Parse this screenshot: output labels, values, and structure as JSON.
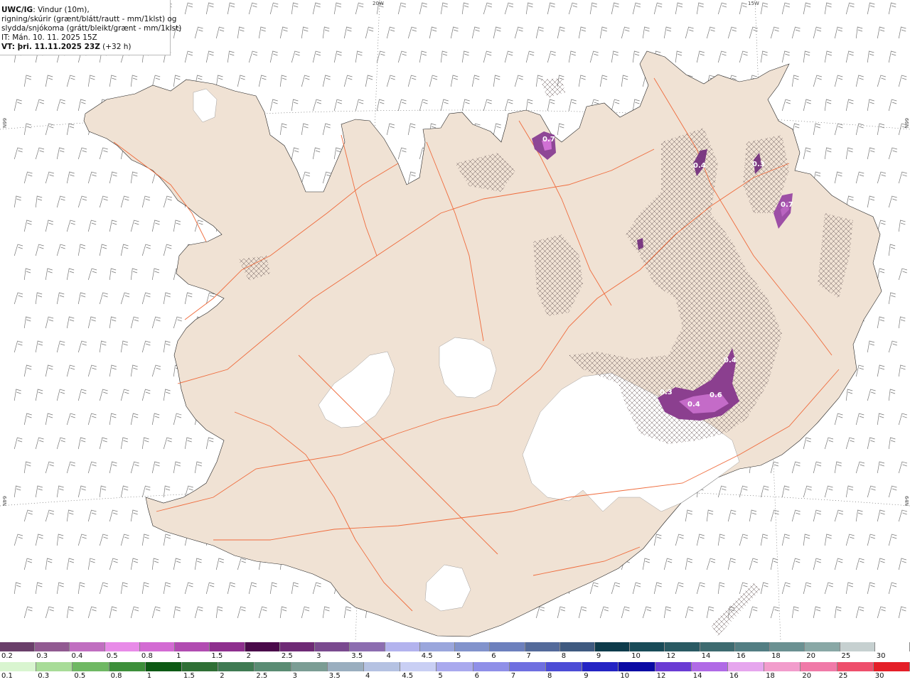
{
  "header": {
    "model": "UWC/IG",
    "title_rest": ": Vindur (10m),",
    "line2": "rigning/skúrir (grænt/blátt/rautt - mm/1klst) og",
    "line3": "slydda/snjókoma (grátt/bleikt/grænt - mm/1klst)",
    "line4": "IT: Mán. 10. 11. 2025 15Z",
    "line5_bold": "VT: þri. 11.11.2025 23Z",
    "line5_rest": " (+32 h)"
  },
  "grid_labels": {
    "lon_20w": "20W",
    "lon_15w": "15W",
    "lat_66n_left": "66N",
    "lat_66n_right": "66N",
    "lat_64n_left": "64N",
    "lat_64n_right": "64N"
  },
  "precip_labels": [
    {
      "text": "0.7"
    },
    {
      "text": "0.4"
    },
    {
      "text": "0.3"
    },
    {
      "text": "0.7"
    },
    {
      "text": "0.4"
    },
    {
      "text": "0.3"
    },
    {
      "text": "0.4"
    },
    {
      "text": "0.6"
    }
  ],
  "legend_snow": {
    "labels": [
      "0.2",
      "0.3",
      "0.4",
      "0.5",
      "0.8",
      "1",
      "1.5",
      "2",
      "2.5",
      "3",
      "3.5",
      "4",
      "4.5",
      "5",
      "6",
      "7",
      "8",
      "9",
      "10",
      "12",
      "14",
      "16",
      "18",
      "20",
      "25",
      "30"
    ],
    "colors": [
      "#6a3f6a",
      "#915a91",
      "#c06ec0",
      "#e88be8",
      "#d36bd3",
      "#b14cb1",
      "#8e2f8e",
      "#4a0a4a",
      "#6e2a75",
      "#7a4a8f",
      "#8c6db0",
      "#b3b3ee",
      "#9aa6dc",
      "#8293cc",
      "#6d80bd",
      "#546a9a",
      "#3f5a80",
      "#0e3b4b",
      "#194b58",
      "#2a5a63",
      "#3e6b70",
      "#537e83",
      "#6b9192",
      "#89a8a6",
      "#c6d0d0",
      "#ffffff"
    ]
  },
  "legend_rain": {
    "labels": [
      "0.1",
      "0.3",
      "0.5",
      "0.8",
      "1",
      "1.5",
      "2",
      "2.5",
      "3",
      "3.5",
      "4",
      "4.5",
      "5",
      "6",
      "7",
      "8",
      "9",
      "10",
      "12",
      "14",
      "16",
      "18",
      "20",
      "25",
      "30"
    ],
    "colors": [
      "#d9f5d0",
      "#a8dc98",
      "#6fb863",
      "#3d8f3a",
      "#0d5a14",
      "#2f6f35",
      "#3f7a52",
      "#5a8c73",
      "#7b9d94",
      "#9aaebf",
      "#b5c2e2",
      "#c9cff4",
      "#a9a9ee",
      "#8f8fe8",
      "#6f6fe0",
      "#4c4cd6",
      "#2424c4",
      "#0a0aa4",
      "#6a3bd4",
      "#b06ae6",
      "#e6a6ee",
      "#f29dcc",
      "#f07aa8",
      "#ee4f6c",
      "#e41f28"
    ]
  }
}
